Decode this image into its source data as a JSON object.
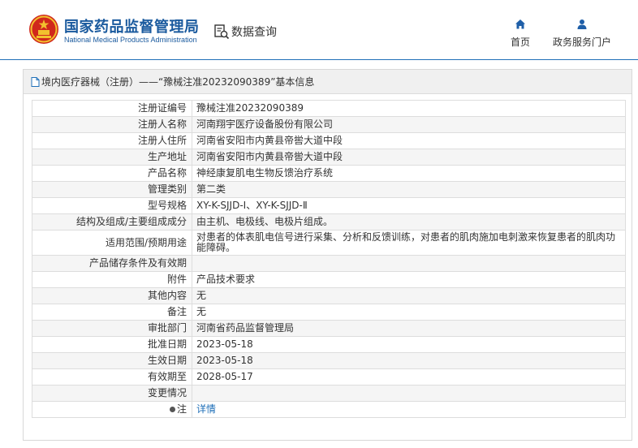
{
  "header": {
    "org_name_cn": "国家药品监督管理局",
    "org_name_en": "National Medical Products Administration",
    "query_label": "数据查询",
    "nav": [
      {
        "label": "首页",
        "icon": "home-icon"
      },
      {
        "label": "政务服务门户",
        "icon": "user-icon"
      }
    ]
  },
  "colors": {
    "brand": "#1a5a9e",
    "link": "#1f6fb8",
    "logo_red": "#d0281c",
    "logo_gold": "#f2c12e"
  },
  "breadcrumb": {
    "icon": "document-icon",
    "text": "境内医疗器械（注册）——“豫械注准20232090389”基本信息"
  },
  "rows": [
    {
      "label": "注册证编号",
      "value": "豫械注准20232090389"
    },
    {
      "label": "注册人名称",
      "value": "河南翔宇医疗设备股份有限公司"
    },
    {
      "label": "注册人住所",
      "value": "河南省安阳市内黄县帝喾大道中段"
    },
    {
      "label": "生产地址",
      "value": "河南省安阳市内黄县帝喾大道中段"
    },
    {
      "label": "产品名称",
      "value": "神经康复肌电生物反馈治疗系统"
    },
    {
      "label": "管理类别",
      "value": "第二类"
    },
    {
      "label": "型号规格",
      "value": "XY-K-SJJD-Ⅰ、XY-K-SJJD-Ⅱ"
    },
    {
      "label": "结构及组成/主要组成成分",
      "value": "由主机、电极线、电极片组成。"
    },
    {
      "label": "适用范围/预期用途",
      "value": "对患者的体表肌电信号进行采集、分析和反馈训练，对患者的肌肉施加电刺激来恢复患者的肌肉功能障碍。"
    },
    {
      "label": "产品储存条件及有效期",
      "value": ""
    },
    {
      "label": "附件",
      "value": "产品技术要求"
    },
    {
      "label": "其他内容",
      "value": "无"
    },
    {
      "label": "备注",
      "value": "无"
    },
    {
      "label": "审批部门",
      "value": "河南省药品监督管理局"
    },
    {
      "label": "批准日期",
      "value": "2023-05-18"
    },
    {
      "label": "生效日期",
      "value": "2023-05-18"
    },
    {
      "label": "有效期至",
      "value": "2028-05-17"
    },
    {
      "label": "变更情况",
      "value": ""
    },
    {
      "label": "注",
      "value": "详情"
    }
  ]
}
